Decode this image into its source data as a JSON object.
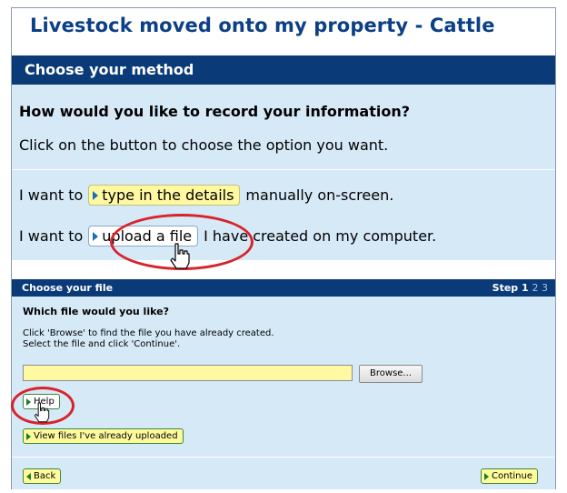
{
  "page": {
    "title": "Livestock moved onto my property - Cattle"
  },
  "method": {
    "header": "Choose your method",
    "question": "How would you like to record your information?",
    "hint": "Click on the button to choose the option you want.",
    "option1": {
      "prefix": "I want to",
      "button": "type in the details",
      "suffix": "manually on-screen."
    },
    "option2": {
      "prefix": "I want to",
      "button": "upload a file",
      "suffix": "I have created on my computer."
    }
  },
  "file_section": {
    "header": "Choose your file",
    "step_label": "Step",
    "step_current": "1",
    "step_rest": "2 3",
    "question": "Which file would you like?",
    "instruction_line1": "Click 'Browse' to find the file you have already created.",
    "instruction_line2": "Select the file and click 'Continue'.",
    "file_value": "",
    "browse_label": "Browse...",
    "help_label": "Help",
    "view_files_label": "View files I've already uploaded"
  },
  "footer": {
    "back_label": "Back",
    "continue_label": "Continue"
  },
  "colors": {
    "title": "#0b3f86",
    "header_bar": "#0a3a78",
    "panel": "#d6e9f7",
    "highlight_ellipse": "#d8232a",
    "input_yellow": "#fff9a4"
  },
  "icons": [
    "pointing-hand-cursor-icon",
    "triangle-right-icon",
    "triangle-left-icon"
  ]
}
